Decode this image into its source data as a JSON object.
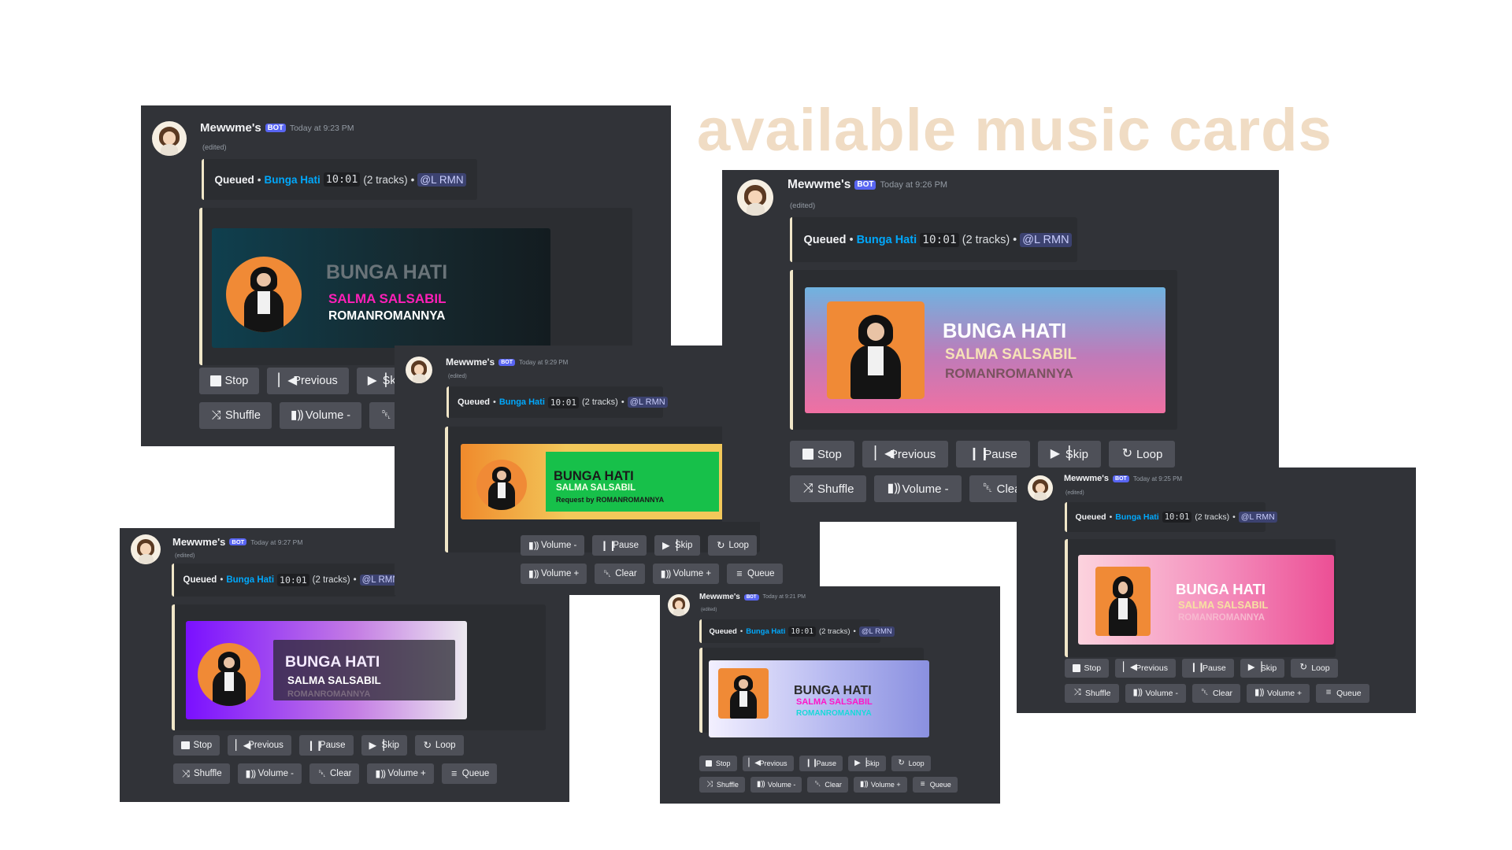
{
  "title": "available music cards",
  "message": {
    "username": "Mewwme's",
    "bot_tag": "BOT",
    "edited": "(edited)",
    "queued_label": "Queued",
    "bullet": "•",
    "track_link": "Bunga Hati",
    "duration": "10:01",
    "track_count": "(2 tracks)",
    "mention": "@L RMN"
  },
  "song": {
    "title_upper": "BUNGA HATI",
    "artist_upper": "SALMA SALSABIL",
    "requester_upper": "ROMANROMANNYA",
    "request_line": "Request by ROMANROMANNYA"
  },
  "buttons": {
    "stop": "Stop",
    "previous": "Previous",
    "pause": "Pause",
    "skip": "Skip",
    "loop": "Loop",
    "shuffle": "Shuffle",
    "volume_down": "Volume -",
    "volume_up": "Volume +",
    "clear": "Clear",
    "queue": "Queue"
  },
  "icons": {
    "stop": "stop-icon",
    "previous": "previous-track-icon",
    "pause": "pause-icon",
    "skip": "skip-icon",
    "loop": "loop-icon",
    "shuffle": "shuffle-icon",
    "volume": "volume-icon",
    "clear": "trash-icon",
    "queue": "queue-list-icon"
  },
  "cards": [
    {
      "timestamp": "Today at 9:23 PM",
      "style": "dark-teal"
    },
    {
      "timestamp": "Today at 9:27 PM",
      "style": "purple-gradient"
    },
    {
      "timestamp": "Today at 9:29 PM",
      "style": "orange-green"
    },
    {
      "timestamp": "Today at 9:21 PM",
      "style": "lavender-blue"
    },
    {
      "timestamp": "Today at 9:26 PM",
      "style": "blue-pink"
    },
    {
      "timestamp": "Today at 9:25 PM",
      "style": "pink-gradient"
    }
  ],
  "colors": {
    "discord_bg": "#313338",
    "embed_bg": "#2b2d31",
    "button": "#4e5058",
    "link": "#00a8fc",
    "bot_badge": "#5865f2",
    "title_beige": "#f0dcc4",
    "magenta": "#ff14c8",
    "green": "#17c04a"
  }
}
